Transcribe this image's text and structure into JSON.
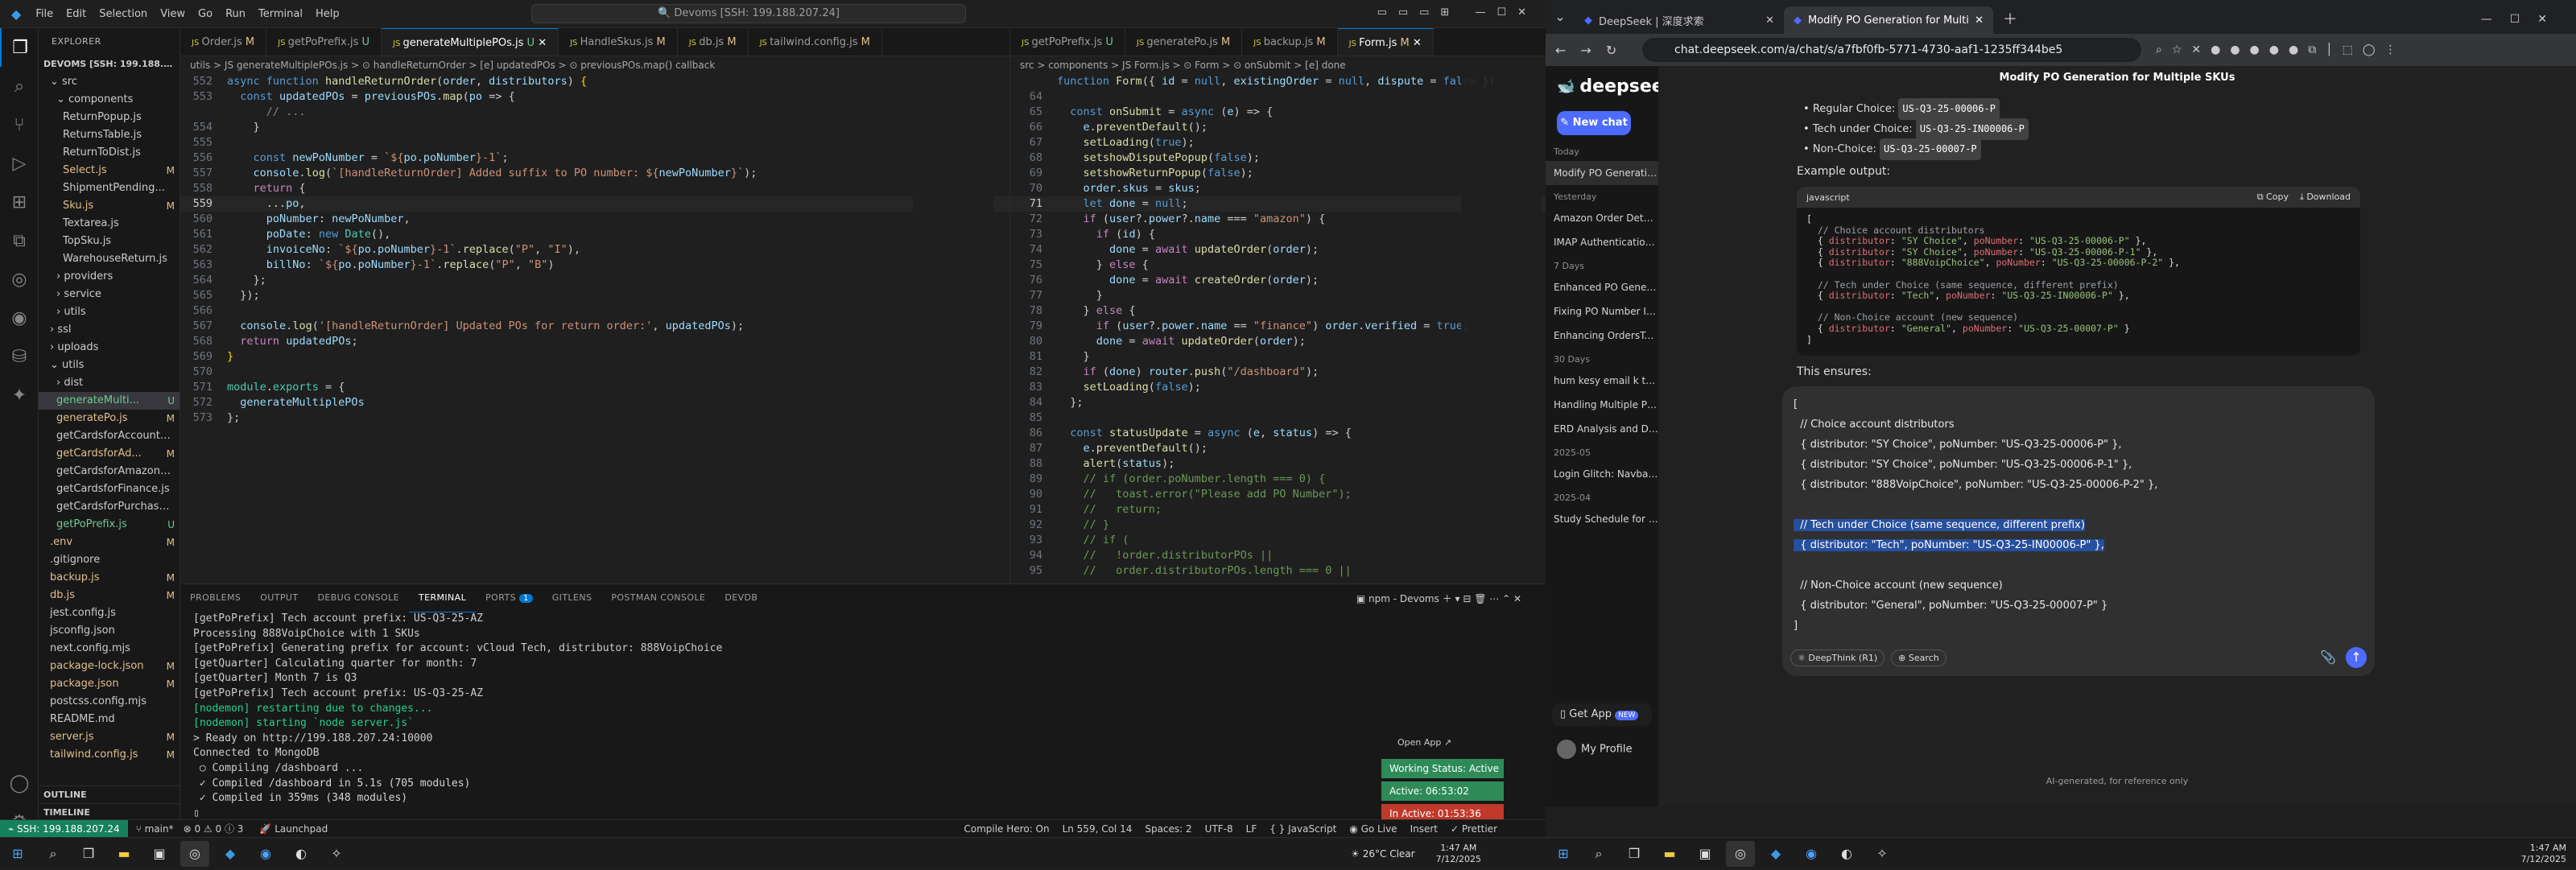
{
  "vscode": {
    "menu": [
      "File",
      "Edit",
      "Selection",
      "View",
      "Go",
      "Run",
      "Terminal",
      "Help"
    ],
    "search": "Devoms [SSH: 199.188.207.24]",
    "explorer_title": "EXPLORER",
    "workspace": "DEVOMS [SSH: 199.188.20...",
    "tree": [
      {
        "name": "src",
        "status": "",
        "indent": 1,
        "type": "folder-open"
      },
      {
        "name": "components",
        "status": "",
        "indent": 2,
        "type": "folder-open"
      },
      {
        "name": "ReturnPopup.js",
        "status": "",
        "indent": 3,
        "type": "file"
      },
      {
        "name": "ReturnsTable.js",
        "status": "",
        "indent": 3,
        "type": "file"
      },
      {
        "name": "ReturnToDist.js",
        "status": "",
        "indent": 3,
        "type": "file"
      },
      {
        "name": "Select.js",
        "status": "M",
        "indent": 3,
        "type": "file"
      },
      {
        "name": "ShipmentPending...",
        "status": "",
        "indent": 3,
        "type": "file"
      },
      {
        "name": "Sku.js",
        "status": "M",
        "indent": 3,
        "type": "file"
      },
      {
        "name": "Textarea.js",
        "status": "",
        "indent": 3,
        "type": "file"
      },
      {
        "name": "TopSku.js",
        "status": "",
        "indent": 3,
        "type": "file"
      },
      {
        "name": "WarehouseReturn.js",
        "status": "",
        "indent": 3,
        "type": "file"
      },
      {
        "name": "providers",
        "status": "",
        "indent": 2,
        "type": "folder"
      },
      {
        "name": "service",
        "status": "",
        "indent": 2,
        "type": "folder"
      },
      {
        "name": "utils",
        "status": "",
        "indent": 2,
        "type": "folder"
      },
      {
        "name": "ssl",
        "status": "",
        "indent": 1,
        "type": "folder"
      },
      {
        "name": "uploads",
        "status": "",
        "indent": 1,
        "type": "folder"
      },
      {
        "name": "utils",
        "status": "",
        "indent": 1,
        "type": "folder-open"
      },
      {
        "name": "dist",
        "status": "",
        "indent": 2,
        "type": "folder"
      },
      {
        "name": "generateMulti...",
        "status": "U",
        "indent": 2,
        "type": "file",
        "selected": true
      },
      {
        "name": "generatePo.js",
        "status": "M",
        "indent": 2,
        "type": "file"
      },
      {
        "name": "getCardsforAccount.js",
        "status": "",
        "indent": 2,
        "type": "file"
      },
      {
        "name": "getCardsforAd...",
        "status": "M",
        "indent": 2,
        "type": "file"
      },
      {
        "name": "getCardsforAmazon.js",
        "status": "",
        "indent": 2,
        "type": "file"
      },
      {
        "name": "getCardsforFinance.js",
        "status": "",
        "indent": 2,
        "type": "file"
      },
      {
        "name": "getCardsforPurchasi...",
        "status": "",
        "indent": 2,
        "type": "file"
      },
      {
        "name": "getPoPrefix.js",
        "status": "U",
        "indent": 2,
        "type": "file"
      },
      {
        "name": ".env",
        "status": "M",
        "indent": 1,
        "type": "file"
      },
      {
        "name": ".gitignore",
        "status": "",
        "indent": 1,
        "type": "file"
      },
      {
        "name": "backup.js",
        "status": "M",
        "indent": 1,
        "type": "file"
      },
      {
        "name": "db.js",
        "status": "M",
        "indent": 1,
        "type": "file"
      },
      {
        "name": "jest.config.js",
        "status": "",
        "indent": 1,
        "type": "file"
      },
      {
        "name": "jsconfig.json",
        "status": "",
        "indent": 1,
        "type": "file"
      },
      {
        "name": "next.config.mjs",
        "status": "",
        "indent": 1,
        "type": "file"
      },
      {
        "name": "package-lock.json",
        "status": "M",
        "indent": 1,
        "type": "file"
      },
      {
        "name": "package.json",
        "status": "M",
        "indent": 1,
        "type": "file"
      },
      {
        "name": "postcss.config.mjs",
        "status": "",
        "indent": 1,
        "type": "file"
      },
      {
        "name": "README.md",
        "status": "",
        "indent": 1,
        "type": "file"
      },
      {
        "name": "server.js",
        "status": "M",
        "indent": 1,
        "type": "file"
      },
      {
        "name": "tailwind.config.js",
        "status": "M",
        "indent": 1,
        "type": "file"
      }
    ],
    "outline": "OUTLINE",
    "timeline": "TIMELINE",
    "tabs_left": [
      {
        "name": "Order.js",
        "status": "M",
        "active": false
      },
      {
        "name": "getPoPrefix.js",
        "status": "U",
        "active": false
      },
      {
        "name": "generateMultiplePOs.js",
        "status": "U",
        "active": true
      },
      {
        "name": "HandleSkus.js",
        "status": "M",
        "active": false
      },
      {
        "name": "db.js",
        "status": "M",
        "active": false
      },
      {
        "name": "tailwind.config.js",
        "status": "M",
        "active": false
      }
    ],
    "tabs_right": [
      {
        "name": "getPoPrefix.js",
        "status": "U",
        "active": false
      },
      {
        "name": "generatePo.js",
        "status": "M",
        "active": false
      },
      {
        "name": "backup.js",
        "status": "M",
        "active": false
      },
      {
        "name": "Form.js",
        "status": "M",
        "active": true
      }
    ],
    "crumb_left": "utils > JS generateMultiplePOs.js > ⊙ handleReturnOrder > [e] updatedPOs > ⊙ previousPOs.map() callback",
    "crumb_right": "src > components > JS Form.js > ⊙ Form > ⊙ onSubmit > [e] done",
    "code_left": [
      {
        "n": "552",
        "t": "<span class='kw'>async</span> <span class='kw'>function</span> <span class='fn'>handleReturnOrder</span>(<span class='var'>order</span>, <span class='var'>distributors</span>) <span class='br'>{</span>"
      },
      {
        "n": "553",
        "t": "  <span class='kw'>const</span> <span class='var'>updatedPOs</span> = <span class='var'>previousPOs</span>.<span class='fn'>map</span>(<span class='var'>po</span> =&gt; {"
      },
      {
        "n": "",
        "t": "      <span style='color:#888'>// ...</span>"
      },
      {
        "n": "554",
        "t": "    }"
      },
      {
        "n": "555",
        "t": ""
      },
      {
        "n": "556",
        "t": "    <span class='kw'>const</span> <span class='var'>newPoNumber</span> = <span class='str'>`${</span><span class='var'>po</span>.<span class='var'>poNumber</span><span class='str'>}-1`</span>;"
      },
      {
        "n": "557",
        "t": "    <span class='var'>console</span>.<span class='fn'>log</span>(<span class='str'>`[handleReturnOrder] Added suffix to PO number: ${</span><span class='var'>newPoNumber</span><span class='str'>}`</span>);"
      },
      {
        "n": "558",
        "t": "    <span class='pu'>return</span> {"
      },
      {
        "n": "559",
        "t": "      ...<span class='var'>po</span>,",
        "cur": true
      },
      {
        "n": "560",
        "t": "      <span class='var'>poNumber</span>: <span class='var'>newPoNumber</span>,"
      },
      {
        "n": "561",
        "t": "      <span class='var'>poDate</span>: <span class='kw'>new</span> <span class='ty'>Date</span>(),"
      },
      {
        "n": "562",
        "t": "      <span class='var'>invoiceNo</span>: <span class='str'>`${</span><span class='var'>po</span>.<span class='var'>poNumber</span><span class='str'>}-1`</span>.<span class='fn'>replace</span>(<span class='str'>\"P\"</span>, <span class='str'>\"I\"</span>),"
      },
      {
        "n": "563",
        "t": "      <span class='var'>billNo</span>: <span class='str'>`${</span><span class='var'>po</span>.<span class='var'>poNumber</span><span class='str'>}-1`</span>.<span class='fn'>replace</span>(<span class='str'>\"P\"</span>, <span class='str'>\"B\"</span>)"
      },
      {
        "n": "564",
        "t": "    };"
      },
      {
        "n": "565",
        "t": "  });"
      },
      {
        "n": "566",
        "t": ""
      },
      {
        "n": "567",
        "t": "  <span class='var'>console</span>.<span class='fn'>log</span>(<span class='str'>'[handleReturnOrder] Updated POs for return order:'</span>, <span class='var'>updatedPOs</span>);"
      },
      {
        "n": "568",
        "t": "  <span class='pu'>return</span> <span class='var'>updatedPOs</span>;"
      },
      {
        "n": "569",
        "t": "<span class='br'>}</span>"
      },
      {
        "n": "570",
        "t": ""
      },
      {
        "n": "571",
        "t": "<span class='ty'>module</span>.<span class='ty'>exports</span> = {"
      },
      {
        "n": "572",
        "t": "  <span class='var'>generateMultiplePOs</span>"
      },
      {
        "n": "573",
        "t": "};"
      }
    ],
    "code_right": [
      {
        "n": "",
        "t": "<span class='kw'>function</span> <span class='fn'>Form</span>({ <span class='var'>id</span> = <span class='kw'>null</span>, <span class='var'>existingOrder</span> = <span class='kw'>null</span>, <span class='var'>dispute</span> = <span class='kw'>false</span> })"
      },
      {
        "n": "64",
        "t": ""
      },
      {
        "n": "65",
        "t": "  <span class='kw'>const</span> <span class='fn'>onSubmit</span> = <span class='kw'>async</span> (<span class='var'>e</span>) =&gt; {"
      },
      {
        "n": "66",
        "t": "    <span class='var'>e</span>.<span class='fn'>preventDefault</span>();"
      },
      {
        "n": "67",
        "t": "    <span class='fn'>setLoading</span>(<span class='kw'>true</span>);"
      },
      {
        "n": "68",
        "t": "    <span class='fn'>setshowDisputePopup</span>(<span class='kw'>false</span>);"
      },
      {
        "n": "69",
        "t": "    <span class='fn'>setshowReturnPopup</span>(<span class='kw'>false</span>);"
      },
      {
        "n": "70",
        "t": "    <span class='var'>order</span>.<span class='var'>skus</span> = <span class='var'>skus</span>;"
      },
      {
        "n": "71",
        "t": "    <span class='kw'>let</span> <span class='var'>done</span> = <span class='kw'>null</span>;",
        "cur": true
      },
      {
        "n": "72",
        "t": "    <span class='pu'>if</span> (<span class='var'>user</span>?.<span class='var'>power</span>?.<span class='var'>name</span> === <span class='str'>\"amazon\"</span>) {"
      },
      {
        "n": "73",
        "t": "      <span class='pu'>if</span> (<span class='var'>id</span>) {"
      },
      {
        "n": "74",
        "t": "        <span class='var'>done</span> = <span class='pu'>await</span> <span class='fn'>updateOrder</span>(<span class='var'>order</span>);"
      },
      {
        "n": "75",
        "t": "      } <span class='pu'>else</span> {"
      },
      {
        "n": "76",
        "t": "        <span class='var'>done</span> = <span class='pu'>await</span> <span class='fn'>createOrder</span>(<span class='var'>order</span>);"
      },
      {
        "n": "77",
        "t": "      }"
      },
      {
        "n": "78",
        "t": "    } <span class='pu'>else</span> {"
      },
      {
        "n": "79",
        "t": "      <span class='pu'>if</span> (<span class='var'>user</span>?.<span class='var'>power</span>.<span class='var'>name</span> == <span class='str'>\"finance\"</span>) <span class='var'>order</span>.<span class='var'>verified</span> = <span class='kw'>true</span>;"
      },
      {
        "n": "80",
        "t": "      <span class='var'>done</span> = <span class='pu'>await</span> <span class='fn'>updateOrder</span>(<span class='var'>order</span>);"
      },
      {
        "n": "81",
        "t": "    }"
      },
      {
        "n": "82",
        "t": "    <span class='pu'>if</span> (<span class='var'>done</span>) <span class='var'>router</span>.<span class='fn'>push</span>(<span class='str'>\"/dashboard\"</span>);"
      },
      {
        "n": "83",
        "t": "    <span class='fn'>setLoading</span>(<span class='kw'>false</span>);"
      },
      {
        "n": "84",
        "t": "  };"
      },
      {
        "n": "85",
        "t": ""
      },
      {
        "n": "86",
        "t": "  <span class='kw'>const</span> <span class='fn'>statusUpdate</span> = <span class='kw'>async</span> (<span class='var'>e</span>, <span class='var'>status</span>) =&gt; {"
      },
      {
        "n": "87",
        "t": "    <span class='var'>e</span>.<span class='fn'>preventDefault</span>();"
      },
      {
        "n": "88",
        "t": "    <span class='fn'>alert</span>(<span class='var'>status</span>);"
      },
      {
        "n": "89",
        "t": "    <span class='cm'>// if (order.poNumber.length === 0) {</span>"
      },
      {
        "n": "90",
        "t": "    <span class='cm'>//   toast.error(\"Please add PO Number\");</span>"
      },
      {
        "n": "91",
        "t": "    <span class='cm'>//   return;</span>"
      },
      {
        "n": "92",
        "t": "    <span class='cm'>// }</span>"
      },
      {
        "n": "93",
        "t": "    <span class='cm'>// if (</span>"
      },
      {
        "n": "94",
        "t": "    <span class='cm'>//   !order.distributorPOs ||</span>"
      },
      {
        "n": "95",
        "t": "    <span class='cm'>//   order.distributorPOs.length === 0 ||</span>"
      }
    ],
    "panel_tabs": [
      "PROBLEMS",
      "OUTPUT",
      "DEBUG CONSOLE",
      "TERMINAL",
      "PORTS",
      "GITLENS",
      "POSTMAN CONSOLE",
      "DEVDB"
    ],
    "ports_badge": "1",
    "terminal_name": "npm - Devoms",
    "terminal_lines": [
      "[getPoPrefix] Tech account prefix: US-Q3-25-AZ",
      "Processing 888VoipChoice with 1 SKUs",
      "[getPoPrefix] Generating prefix for account: vCloud Tech, distributor: 888VoipChoice",
      "[getQuarter] Calculating quarter for month: 7",
      "[getQuarter] Month 7 is Q3",
      "[getPoPrefix] Tech account prefix: US-Q3-25-AZ",
      "[nodemon] restarting due to changes...",
      "[nodemon] starting `node server.js`",
      "> Ready on http://199.188.207.24:10000",
      "Connected to MongoDB",
      " ○ Compiling /dashboard ...",
      " ✓ Compiled /dashboard in 5.1s (705 modules)",
      " ✓ Compiled in 359ms (348 modules)"
    ],
    "open_app": "Open App ↗",
    "working_status": "Working Status: Active",
    "active_time": "Active: 06:53:02",
    "inactive_time": "In Active: 01:53:36",
    "status": {
      "remote": "SSH: 199.188.207.24",
      "branch": "main*",
      "errors": "0",
      "warnings": "0",
      "info": "3",
      "launchpad": "Launchpad",
      "compile": "Compile Hero: On",
      "position": "Ln 559, Col 14",
      "spaces": "Spaces: 2",
      "encoding": "UTF-8",
      "eol": "LF",
      "language": "JavaScript",
      "golive": "Go Live",
      "insert": "Insert",
      "prettier": "Prettier"
    }
  },
  "browser": {
    "tabs": [
      {
        "title": "DeepSeek | 深度求索",
        "active": false
      },
      {
        "title": "Modify PO Generation for Multi",
        "active": true
      }
    ],
    "url": "chat.deepseek.com/a/chat/s/a7fbf0fb-5771-4730-aaf1-1235ff344be5",
    "ds": {
      "logo": "deepseek",
      "new_chat": "New chat",
      "groups": [
        {
          "label": "Today",
          "items": [
            "Modify PO Generation for M"
          ]
        },
        {
          "label": "Yesterday",
          "items": [
            "Amazon Order Details for Surge",
            "IMAP Authentication Timeout Er"
          ]
        },
        {
          "label": "7 Days",
          "items": [
            "Enhanced PO Generation for Mu",
            "Fixing PO Number Increment Is",
            "Enhancing OrdersTable with Pro"
          ]
        },
        {
          "label": "30 Days",
          "items": [
            "hum kesy email k through code",
            "Handling Multiple POs and TXW",
            "ERD Analysis and Database Mod"
          ]
        },
        {
          "label": "2025-05",
          "items": [
            "Login Glitch: Navbar Appears Af"
          ]
        },
        {
          "label": "2025-04",
          "items": [
            "Study Schedule for Foundation L"
          ]
        }
      ],
      "get_app": "Get App",
      "new_badge": "NEW",
      "my_profile": "My Profile",
      "chat_title": "Modify PO Generation for Multiple SKUs",
      "bullets": [
        {
          "label": "Regular Choice:",
          "code": "US-Q3-25-00006-P"
        },
        {
          "label": "Tech under Choice:",
          "code": "US-Q3-25-IN00006-P"
        },
        {
          "label": "Non-Choice:",
          "code": "US-Q3-25-00007-P"
        }
      ],
      "example_label": "Example output:",
      "code_lang": "javascript",
      "copy": "Copy",
      "download": "Download",
      "code_lines": [
        "[",
        "  // Choice account distributors",
        "  { distributor: \"SY Choice\", poNumber: \"US-Q3-25-00006-P\" },",
        "  { distributor: \"SY Choice\", poNumber: \"US-Q3-25-00006-P-1\" },",
        "  { distributor: \"888VoipChoice\", poNumber: \"US-Q3-25-00006-P-2\" },",
        "",
        "  // Tech under Choice (same sequence, different prefix)",
        "  { distributor: \"Tech\", poNumber: \"US-Q3-25-IN00006-P\" },",
        "",
        "  // Non-Choice account (new sequence)",
        "  { distributor: \"General\", poNumber: \"US-Q3-25-00007-P\" }",
        "]"
      ],
      "ensures": "This ensures:",
      "input_lines": [
        "[",
        "  // Choice account distributors",
        "  { distributor: \"SY Choice\", poNumber: \"US-Q3-25-00006-P\" },",
        "  { distributor: \"SY Choice\", poNumber: \"US-Q3-25-00006-P-1\" },",
        "  { distributor: \"888VoipChoice\", poNumber: \"US-Q3-25-00006-P-2\" },",
        "",
        "  // Tech under Choice (same sequence, different prefix)",
        "  { distributor: \"Tech\", poNumber: \"US-Q3-25-IN00006-P\" },",
        "",
        "  // Non-Choice account (new sequence)",
        "  { distributor: \"General\", poNumber: \"US-Q3-25-00007-P\" }",
        "]"
      ],
      "deepthink": "DeepThink (R1)",
      "search": "Search",
      "disclaimer": "AI-generated, for reference only"
    }
  },
  "taskbar": {
    "weather": "26°C  Clear",
    "time_left": "1:47 AM",
    "date_left": "7/12/2025",
    "time_right": "1:47 AM",
    "date_right": "7/12/2025"
  },
  "colors": {
    "accent": "#0078d4",
    "ds_blue": "#4d6bfe",
    "modified": "#e2c08d",
    "untracked": "#73c991",
    "active_green": "#2e8b57",
    "inactive_red": "#c0392b",
    "selection": "#264f9e"
  }
}
